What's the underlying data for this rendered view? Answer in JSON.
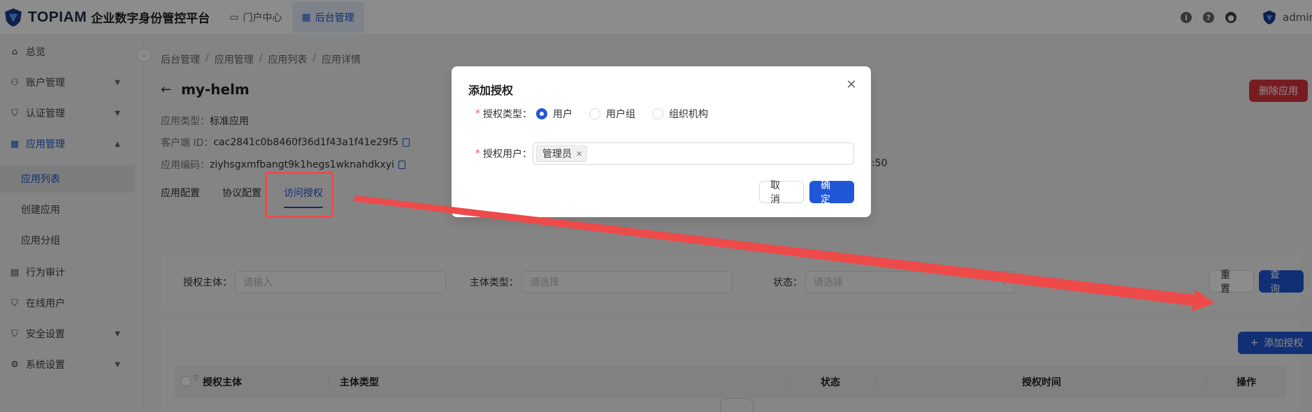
{
  "header": {
    "logo_word": "TOPIAM",
    "logo_title": "企业数字身份管控平台",
    "nav": [
      {
        "label": "门户中心",
        "icon": "monitor-icon"
      },
      {
        "label": "后台管理",
        "icon": "dashboard-icon"
      }
    ],
    "user": "admin"
  },
  "sidebar": {
    "items": [
      {
        "label": "总览",
        "icon": "home-icon"
      },
      {
        "label": "账户管理",
        "icon": "users-icon"
      },
      {
        "label": "认证管理",
        "icon": "shield-icon"
      },
      {
        "label": "应用管理",
        "icon": "apps-icon"
      },
      {
        "label": "行为审计",
        "icon": "audit-icon"
      },
      {
        "label": "在线用户",
        "icon": "online-icon"
      },
      {
        "label": "安全设置",
        "icon": "security-icon"
      },
      {
        "label": "系统设置",
        "icon": "settings-icon"
      }
    ],
    "sub_items": [
      "应用列表",
      "创建应用",
      "应用分组"
    ]
  },
  "breadcrumb": [
    "后台管理",
    "应用管理",
    "应用列表",
    "应用详情"
  ],
  "app": {
    "name": "my-helm",
    "delete_label": "删除应用",
    "type_label": "应用类型：",
    "type_value": "标准应用",
    "client_id_label": "客户端 ID：",
    "client_id_value": "cac2841c0b8460f36d1f43a1f41e29f5",
    "code_label": "应用编码：",
    "code_value": "ziyhsgxmfbangt9k1hegs1wknahdkxyi",
    "partial_time": ":50"
  },
  "tabs": [
    "应用配置",
    "协议配置",
    "访问授权"
  ],
  "filters": {
    "subject_label": "授权主体：",
    "subject_placeholder": "请输入",
    "type_label": "主体类型：",
    "type_placeholder": "请选择",
    "status_label": "状态：",
    "status_placeholder": "请选择",
    "reset_label": "重 置",
    "query_label": "查 询"
  },
  "table": {
    "add_label": "添加授权",
    "columns": [
      "授权主体",
      "主体类型",
      "状态",
      "授权时间",
      "操作"
    ]
  },
  "modal": {
    "title": "添加授权",
    "type_label": "授权类型：",
    "options": [
      "用户",
      "用户组",
      "组织机构"
    ],
    "selected": "用户",
    "user_label": "授权用户：",
    "selected_tag": "管理员",
    "cancel_label": "取 消",
    "ok_label": "确 定"
  },
  "colors": {
    "primary": "#1f57d6",
    "danger": "#d9363e",
    "annotation": "#ee4a4a"
  }
}
